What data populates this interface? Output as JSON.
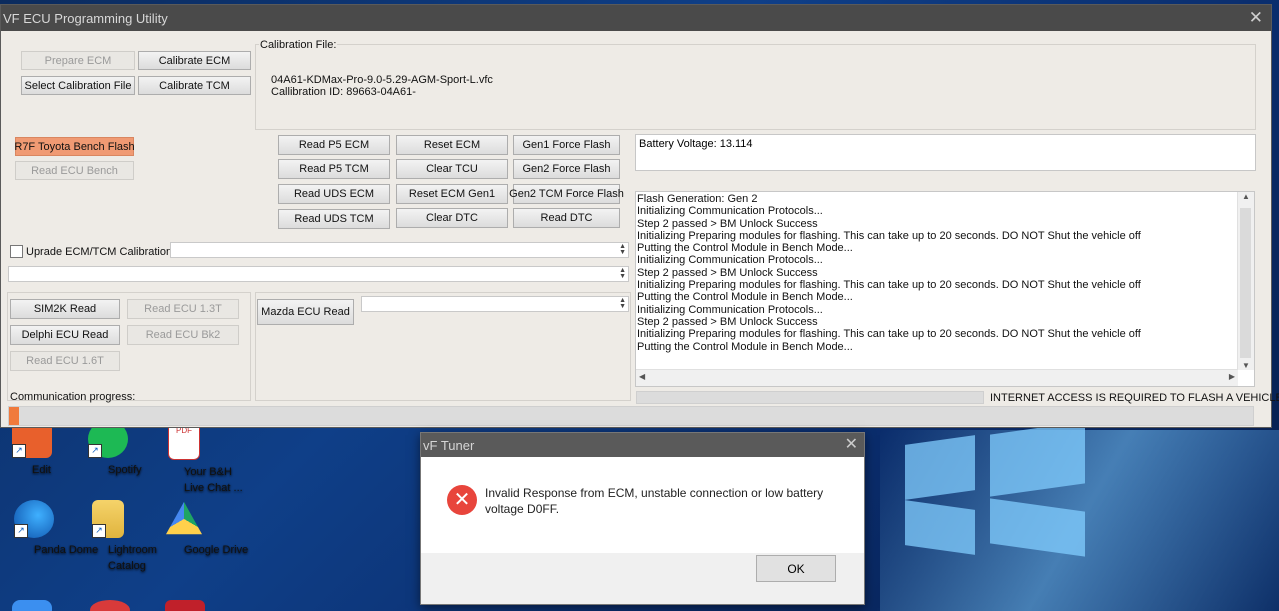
{
  "window": {
    "title": "VF ECU Programming Utility"
  },
  "top_buttons": {
    "prepare_ecm": "Prepare ECM",
    "calibrate_ecm": "Calibrate ECM",
    "select_calibration_file": "Select Calibration File",
    "calibrate_tcm": "Calibrate TCM"
  },
  "calibration": {
    "header": "Calibration File:",
    "file": "04A61-KDMax-Pro-9.0-5.29-AGM-Sport-L.vfc",
    "id": "Callibration ID: 89663-04A61-"
  },
  "left_buttons": {
    "r7f": "R7F Toyota Bench Flash",
    "read_ecu_bench": "Read ECU Bench"
  },
  "grid_buttons": {
    "read_p5_ecm": "Read P5 ECM",
    "reset_ecm": "Reset ECM",
    "gen1_force_flash": "Gen1 Force Flash",
    "read_p5_tcm": "Read P5 TCM",
    "clear_tcu": "Clear TCU",
    "gen2_force_flash": "Gen2 Force Flash",
    "read_uds_ecm": "Read UDS ECM",
    "reset_ecm_gen1": "Reset ECM Gen1",
    "gen2_tcm_force_flash": "Gen2 TCM Force Flash",
    "read_uds_tcm": "Read UDS TCM",
    "clear_dtc": "Clear DTC",
    "read_dtc": "Read DTC"
  },
  "upgrade_checkbox": "Uprade ECM/TCM Calibration",
  "bottom_buttons": {
    "sim2k_read": "SIM2K Read",
    "read_ecu_13t": "Read ECU 1.3T",
    "delphi_ecu_read": "Delphi ECU Read",
    "read_ecu_bk2": "Read ECU Bk2",
    "read_ecu_16t": "Read ECU 1.6T",
    "mazda_ecu_read": "Mazda ECU Read"
  },
  "progress": {
    "label": "Communication progress:",
    "value": 0.008
  },
  "battery": "Battery Voltage: 13.114",
  "log": [
    "Flash Generation: Gen 2",
    "Initializing Communication Protocols...",
    "Step 2 passed > BM Unlock Success",
    "Initializing Preparing modules for flashing. This can take up to 20 seconds. DO NOT Shut the vehicle off",
    "Putting the Control Module in Bench Mode...",
    "Initializing Communication Protocols...",
    "Step 2 passed > BM Unlock Success",
    "Initializing Preparing modules for flashing. This can take up to 20 seconds. DO NOT Shut the vehicle off",
    "Putting the Control Module in Bench Mode...",
    "Initializing Communication Protocols...",
    "Step 2 passed > BM Unlock Success",
    "Initializing Preparing modules for flashing. This can take up to 20 seconds. DO NOT Shut the vehicle off",
    "Putting the Control Module in Bench Mode..."
  ],
  "internet_notice": "INTERNET ACCESS IS REQUIRED TO FLASH A VEHICLE",
  "desktop_icons": {
    "edit": "Edit",
    "spotify": "Spotify",
    "bh_line1": "Your B&H",
    "bh_line2": "Live Chat ...",
    "pdf_badge": "PDF",
    "panda": "Panda Dome",
    "lightroom_line1": "Lightroom",
    "lightroom_line2": "Catalog",
    "gdrive": "Google Drive"
  },
  "dialog": {
    "title": "vF Tuner",
    "message": "Invalid Response from ECM, unstable connection or low battery voltage D0FF.",
    "ok": "OK"
  },
  "colors": {
    "r7f_button": "#f09a73",
    "titlebar": "#4a4a4a",
    "progress_fill": "#f07a3c",
    "error_icon": "#e8453c"
  }
}
